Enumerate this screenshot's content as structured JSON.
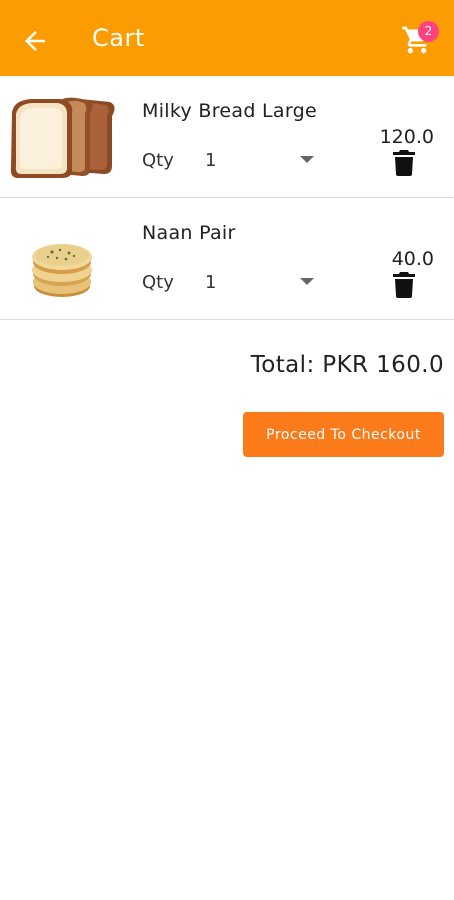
{
  "appbar": {
    "title": "Cart",
    "back_icon": "arrow-left-icon",
    "cart_icon": "shopping-cart-icon",
    "cart_count": "2",
    "bg_color": "#fb9c00",
    "badge_color": "#ff4081"
  },
  "cart": {
    "items": [
      {
        "name": "Milky Bread Large",
        "qty_label": "Qty",
        "qty": "1",
        "price": "120.0",
        "image": "sliced-bread-image",
        "delete_icon": "trash-icon"
      },
      {
        "name": "Naan Pair",
        "qty_label": "Qty",
        "qty": "1",
        "price": "40.0",
        "image": "naan-bread-image",
        "delete_icon": "trash-icon"
      }
    ]
  },
  "summary": {
    "total": "Total: PKR 160.0",
    "checkout_label": "Proceed To Checkout",
    "checkout_color": "#fb7b1b"
  }
}
